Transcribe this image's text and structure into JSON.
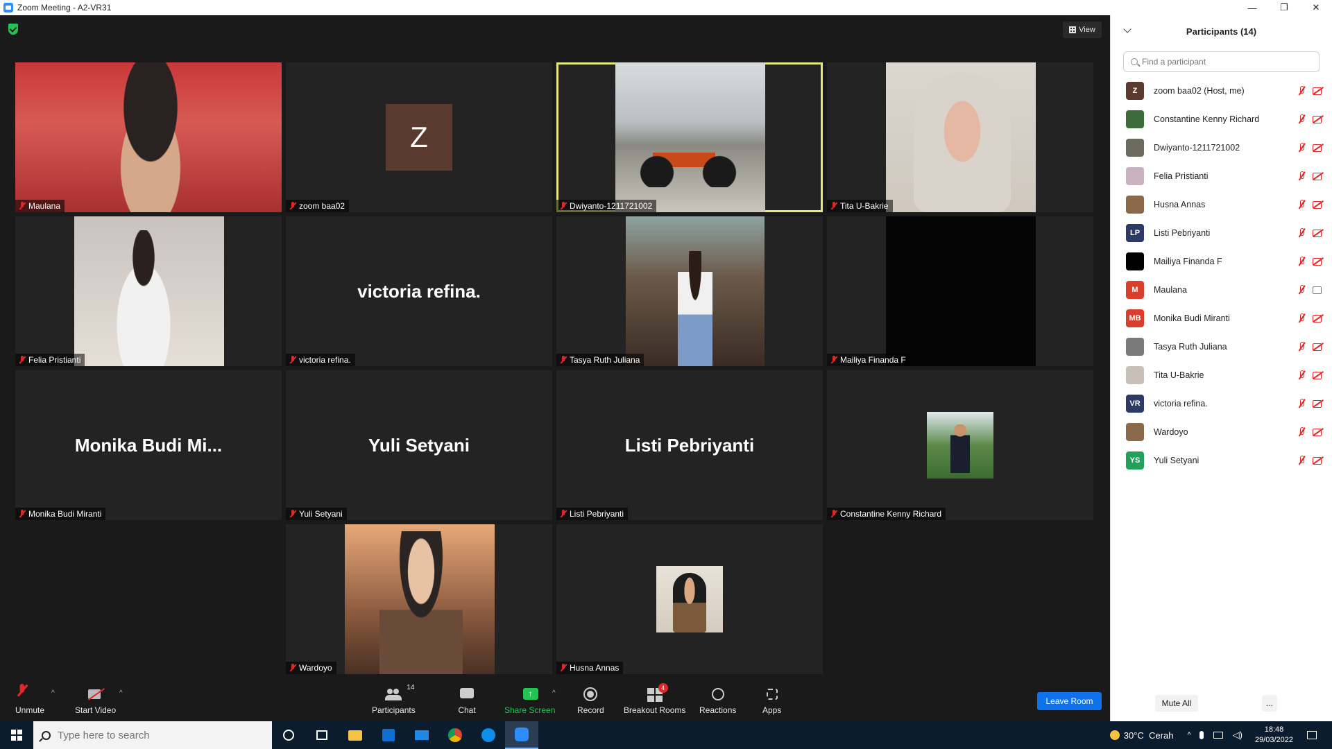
{
  "window": {
    "title": "Zoom Meeting - A2-VR31",
    "minimize": "—",
    "restore": "❐",
    "close": "✕"
  },
  "meeting": {
    "view_label": "View"
  },
  "tiles": [
    {
      "name": "Maulana",
      "kind": "photo"
    },
    {
      "name": "zoom baa02",
      "kind": "avatar",
      "avatar": "Z"
    },
    {
      "name": "Dwiyanto-1211721002",
      "kind": "photo",
      "active": true
    },
    {
      "name": "Tita U-Bakrie",
      "kind": "photo"
    },
    {
      "name": "Felia Pristianti",
      "kind": "photo"
    },
    {
      "name": "victoria refina.",
      "kind": "text",
      "display": "victoria refina."
    },
    {
      "name": "Tasya Ruth Juliana",
      "kind": "photo"
    },
    {
      "name": "Mailiya Finanda F",
      "kind": "black"
    },
    {
      "name": "Monika Budi Miranti",
      "kind": "text",
      "display": "Monika Budi Mi..."
    },
    {
      "name": "Yuli Setyani",
      "kind": "text",
      "display": "Yuli Setyani"
    },
    {
      "name": "Listi Pebriyanti",
      "kind": "text",
      "display": "Listi Pebriyanti"
    },
    {
      "name": "Constantine Kenny Richard",
      "kind": "small-photo"
    },
    {
      "name": "Wardoyo",
      "kind": "photo"
    },
    {
      "name": "Husna Annas",
      "kind": "small-photo"
    }
  ],
  "toolbar": {
    "unmute": "Unmute",
    "start_video": "Start Video",
    "participants": "Participants",
    "participants_count": "14",
    "chat": "Chat",
    "share_screen": "Share Screen",
    "record": "Record",
    "breakout_rooms": "Breakout Rooms",
    "breakout_badge": "4",
    "reactions": "Reactions",
    "apps": "Apps",
    "leave_room": "Leave Room"
  },
  "panel": {
    "title": "Participants (14)",
    "search_placeholder": "Find a participant",
    "mute_all": "Mute All",
    "more": "...",
    "participants": [
      {
        "name": "zoom baa02 (Host, me)",
        "initials": "Z",
        "color": "#5a3a2e",
        "video": false
      },
      {
        "name": "Constantine Kenny Richard",
        "initials": "",
        "color": "#3d6b3a",
        "video": false
      },
      {
        "name": "Dwiyanto-1211721002",
        "initials": "",
        "color": "#6b6b5e",
        "video": false
      },
      {
        "name": "Felia Pristianti",
        "initials": "",
        "color": "#c9b2c0",
        "video": false
      },
      {
        "name": "Husna Annas",
        "initials": "",
        "color": "#8a6a4a",
        "video": false
      },
      {
        "name": "Listi Pebriyanti",
        "initials": "LP",
        "color": "#2d3a66",
        "video": false
      },
      {
        "name": "Mailiya Finanda F",
        "initials": "",
        "color": "#000000",
        "video": false
      },
      {
        "name": "Maulana",
        "initials": "M",
        "color": "#d93f2b",
        "video": true
      },
      {
        "name": "Monika Budi Miranti",
        "initials": "MB",
        "color": "#d93f2b",
        "video": false
      },
      {
        "name": "Tasya Ruth Juliana",
        "initials": "",
        "color": "#7a7a7a",
        "video": false
      },
      {
        "name": "Tita U-Bakrie",
        "initials": "",
        "color": "#c8c0b8",
        "video": false
      },
      {
        "name": "victoria refina.",
        "initials": "VR",
        "color": "#2d3a66",
        "video": false
      },
      {
        "name": "Wardoyo",
        "initials": "",
        "color": "#8a6a4a",
        "video": false
      },
      {
        "name": "Yuli Setyani",
        "initials": "YS",
        "color": "#23a05a",
        "video": false
      }
    ]
  },
  "taskbar": {
    "search_placeholder": "Type here to search",
    "weather": "30°C  Cerah",
    "time": "18:48",
    "date": "29/03/2022"
  }
}
